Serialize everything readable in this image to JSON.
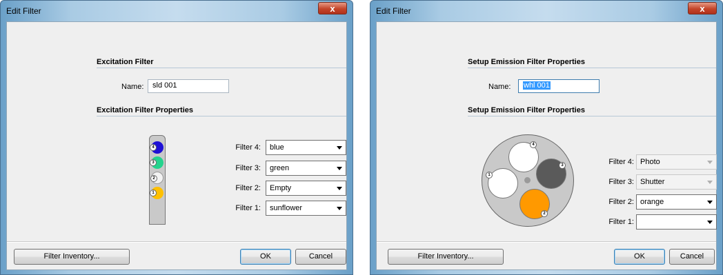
{
  "left": {
    "title": "Edit Filter",
    "close_label": "x",
    "section1_title": "Excitation Filter",
    "name_label": "Name:",
    "name_value": "sld 001",
    "section2_title": "Excitation Filter Properties",
    "filters": [
      {
        "label": "Filter 4:",
        "value": "blue",
        "enabled": true
      },
      {
        "label": "Filter 3:",
        "value": "green",
        "enabled": true
      },
      {
        "label": "Filter 2:",
        "value": "Empty",
        "enabled": true
      },
      {
        "label": "Filter 1:",
        "value": "sunflower",
        "enabled": true
      }
    ],
    "slider_positions": [
      {
        "number": "4",
        "color": "#1e10d6"
      },
      {
        "number": "3",
        "color": "#24d38d"
      },
      {
        "number": "2",
        "color": "#f2f2f2"
      },
      {
        "number": "1",
        "color": "#ffc000"
      }
    ],
    "inventory_button": "Filter Inventory...",
    "ok_button": "OK",
    "cancel_button": "Cancel"
  },
  "right": {
    "title": "Edit Filter",
    "close_label": "x",
    "section1_title": "Setup Emission Filter Properties",
    "name_label": "Name:",
    "name_value": "whl 001",
    "section2_title": "Setup Emission Filter Properties",
    "filters": [
      {
        "label": "Filter 4:",
        "value": "Photo",
        "enabled": false
      },
      {
        "label": "Filter 3:",
        "value": "Shutter",
        "enabled": false
      },
      {
        "label": "Filter 2:",
        "value": "orange",
        "enabled": true
      },
      {
        "label": "Filter 1:",
        "value": "",
        "enabled": true
      }
    ],
    "wheel_positions": [
      {
        "number": "4",
        "color": "#ffffff"
      },
      {
        "number": "3",
        "color": "#5a5a5a"
      },
      {
        "number": "2",
        "color": "#ff9900"
      },
      {
        "number": "1",
        "color": "#ffffff"
      }
    ],
    "inventory_button": "Filter Inventory...",
    "ok_button": "OK",
    "cancel_button": "Cancel"
  }
}
